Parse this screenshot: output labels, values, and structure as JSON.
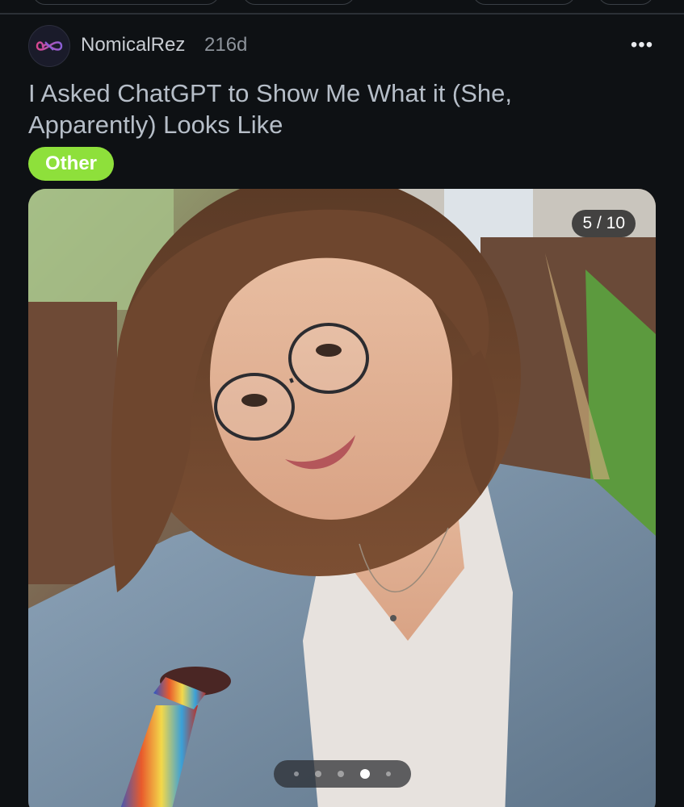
{
  "post": {
    "username": "NomicalRez",
    "age": "216d",
    "title": "I Asked ChatGPT to Show Me What it (She, Apparently) Looks Like",
    "flair": "Other",
    "flair_color": "#8ee03b",
    "more_icon": "more-horizontal-icon"
  },
  "media": {
    "counter": "5 / 10",
    "current_index": 5,
    "total": 10,
    "image_description_icon": "photo-image"
  },
  "colors": {
    "background": "#0e1114",
    "title": "#b6bec8",
    "username": "#c8ccd2"
  }
}
